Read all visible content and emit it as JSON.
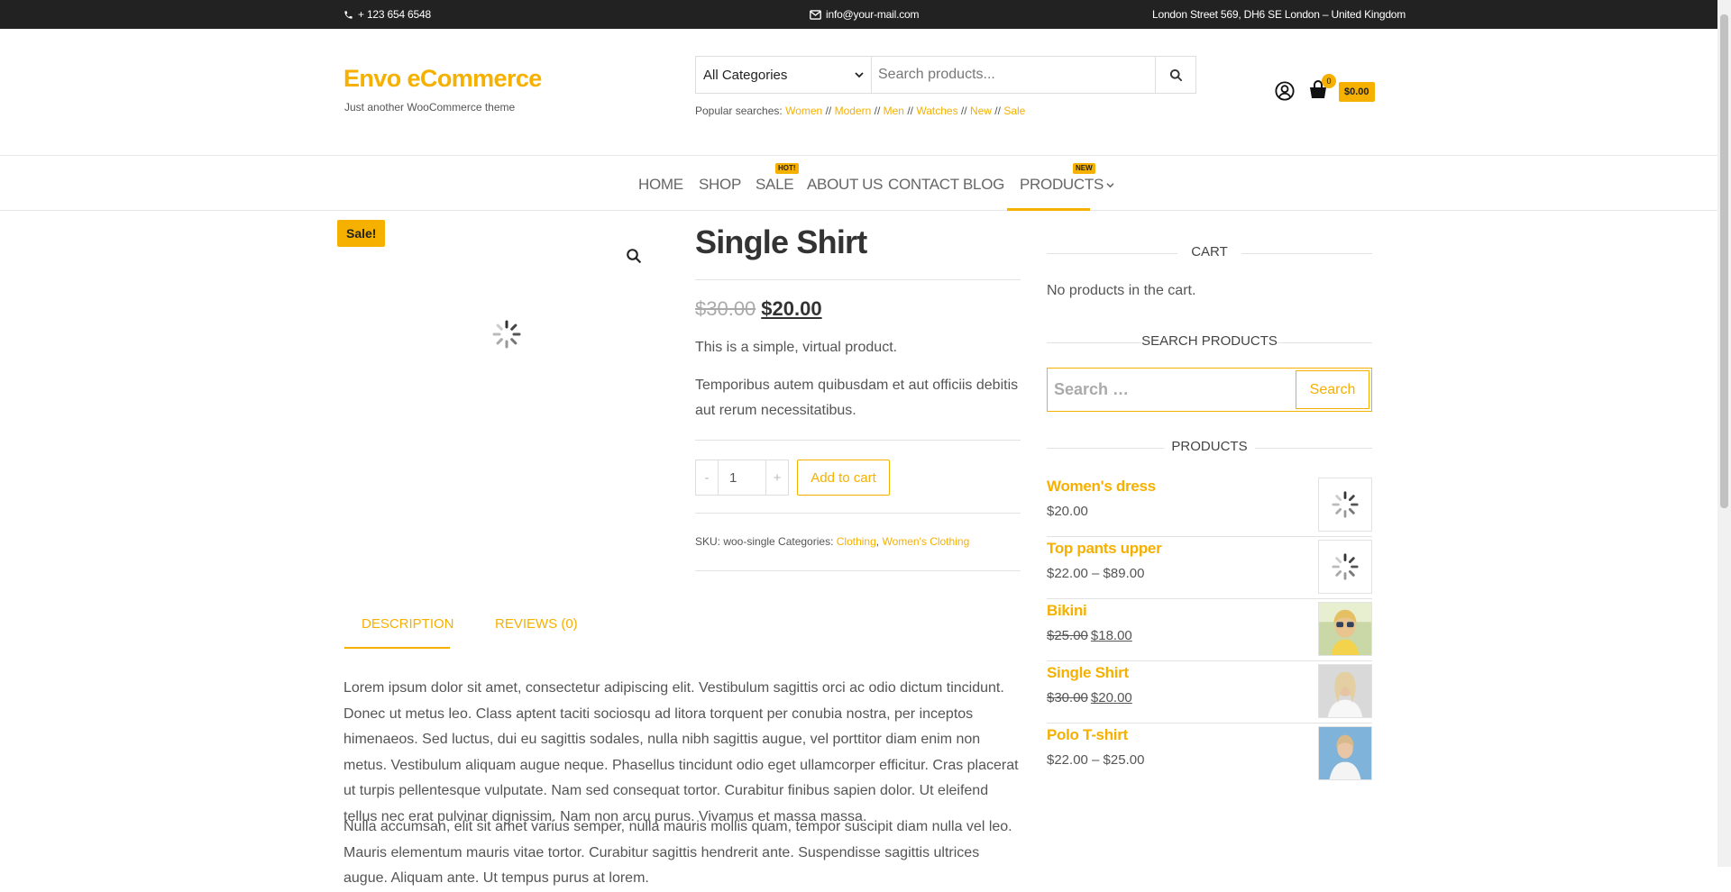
{
  "topbar": {
    "phone": "+ 123 654 6548",
    "email": "info@your-mail.com",
    "address": "London Street 569, DH6 SE London – United Kingdom"
  },
  "header": {
    "site_title": "Envo eCommerce",
    "tagline": "Just another WooCommerce theme",
    "category_select": "All Categories",
    "search_placeholder": "Search products...",
    "popular_label": "Popular searches:",
    "popular": [
      "Women",
      "Modern",
      "Men",
      "Watches",
      "New",
      "Sale"
    ],
    "separator": "//",
    "cart_count": "0",
    "cart_total": "$0.00"
  },
  "nav": {
    "items": [
      "HOME",
      "SHOP",
      "SALE",
      "ABOUT US",
      "CONTACT",
      "BLOG",
      "PRODUCTS"
    ],
    "sale_badge": "HOT!",
    "products_badge": "NEW"
  },
  "product": {
    "sale_badge": "Sale!",
    "title": "Single Shirt",
    "old_price": "$30.00",
    "price": "$20.00",
    "short_desc_1": "This is a simple, virtual product.",
    "short_desc_2": "Temporibus autem quibusdam et aut officiis debitis aut rerum necessitatibus.",
    "qty_minus": "-",
    "qty_value": "1",
    "qty_plus": "+",
    "add_to_cart": "Add to cart",
    "meta_prefix": "SKU: woo-single Categories:",
    "category_1": "Clothing",
    "category_sep": ",",
    "category_2": "Women's Clothing"
  },
  "tabs": {
    "description": "DESCRIPTION",
    "reviews": "REVIEWS (0)"
  },
  "description": {
    "p1": "Lorem ipsum dolor sit amet, consectetur adipiscing elit. Vestibulum sagittis orci ac odio dictum tincidunt. Donec ut metus leo. Class aptent taciti sociosqu ad litora torquent per conubia nostra, per inceptos himenaeos. Sed luctus, dui eu sagittis sodales, nulla nibh sagittis augue, vel porttitor diam enim non metus. Vestibulum aliquam augue neque. Phasellus tincidunt odio eget ullamcorper efficitur. Cras placerat ut turpis pellentesque vulputate. Nam sed consequat tortor. Curabitur finibus sapien dolor. Ut eleifend tellus nec erat pulvinar dignissim. Nam non arcu purus. Vivamus et massa massa.",
    "p2": "Nulla accumsan, elit sit amet varius semper, nulla mauris mollis quam, tempor suscipit diam nulla vel leo. Mauris elementum mauris vitae tortor. Curabitur sagittis hendrerit ante. Suspendisse sagittis ultrices augue. Aliquam ante. Ut tempus purus at lorem."
  },
  "sidebar": {
    "cart_title": "CART",
    "cart_empty": "No products in the cart.",
    "search_title": "SEARCH PRODUCTS",
    "search_placeholder": "Search …",
    "search_button": "Search",
    "products_title": "PRODUCTS",
    "products": [
      {
        "name": "Women's dress",
        "price": "$20.00"
      },
      {
        "name": "Top pants upper",
        "price": "$22.00 – $89.00"
      },
      {
        "name": "Bikini",
        "old_price": "$25.00",
        "price": "$18.00"
      },
      {
        "name": "Single Shirt",
        "old_price": "$30.00",
        "price": "$20.00"
      },
      {
        "name": "Polo T-shirt",
        "price": "$22.00 – $25.00"
      }
    ]
  },
  "colors": {
    "accent": "#f5b000",
    "topbar": "#222222",
    "text": "#555555"
  },
  "icons": [
    "phone-icon",
    "envelope-icon",
    "search-icon",
    "chevron-down-icon",
    "user-icon",
    "shopping-bag-icon",
    "zoom-icon",
    "spinner-icon"
  ]
}
